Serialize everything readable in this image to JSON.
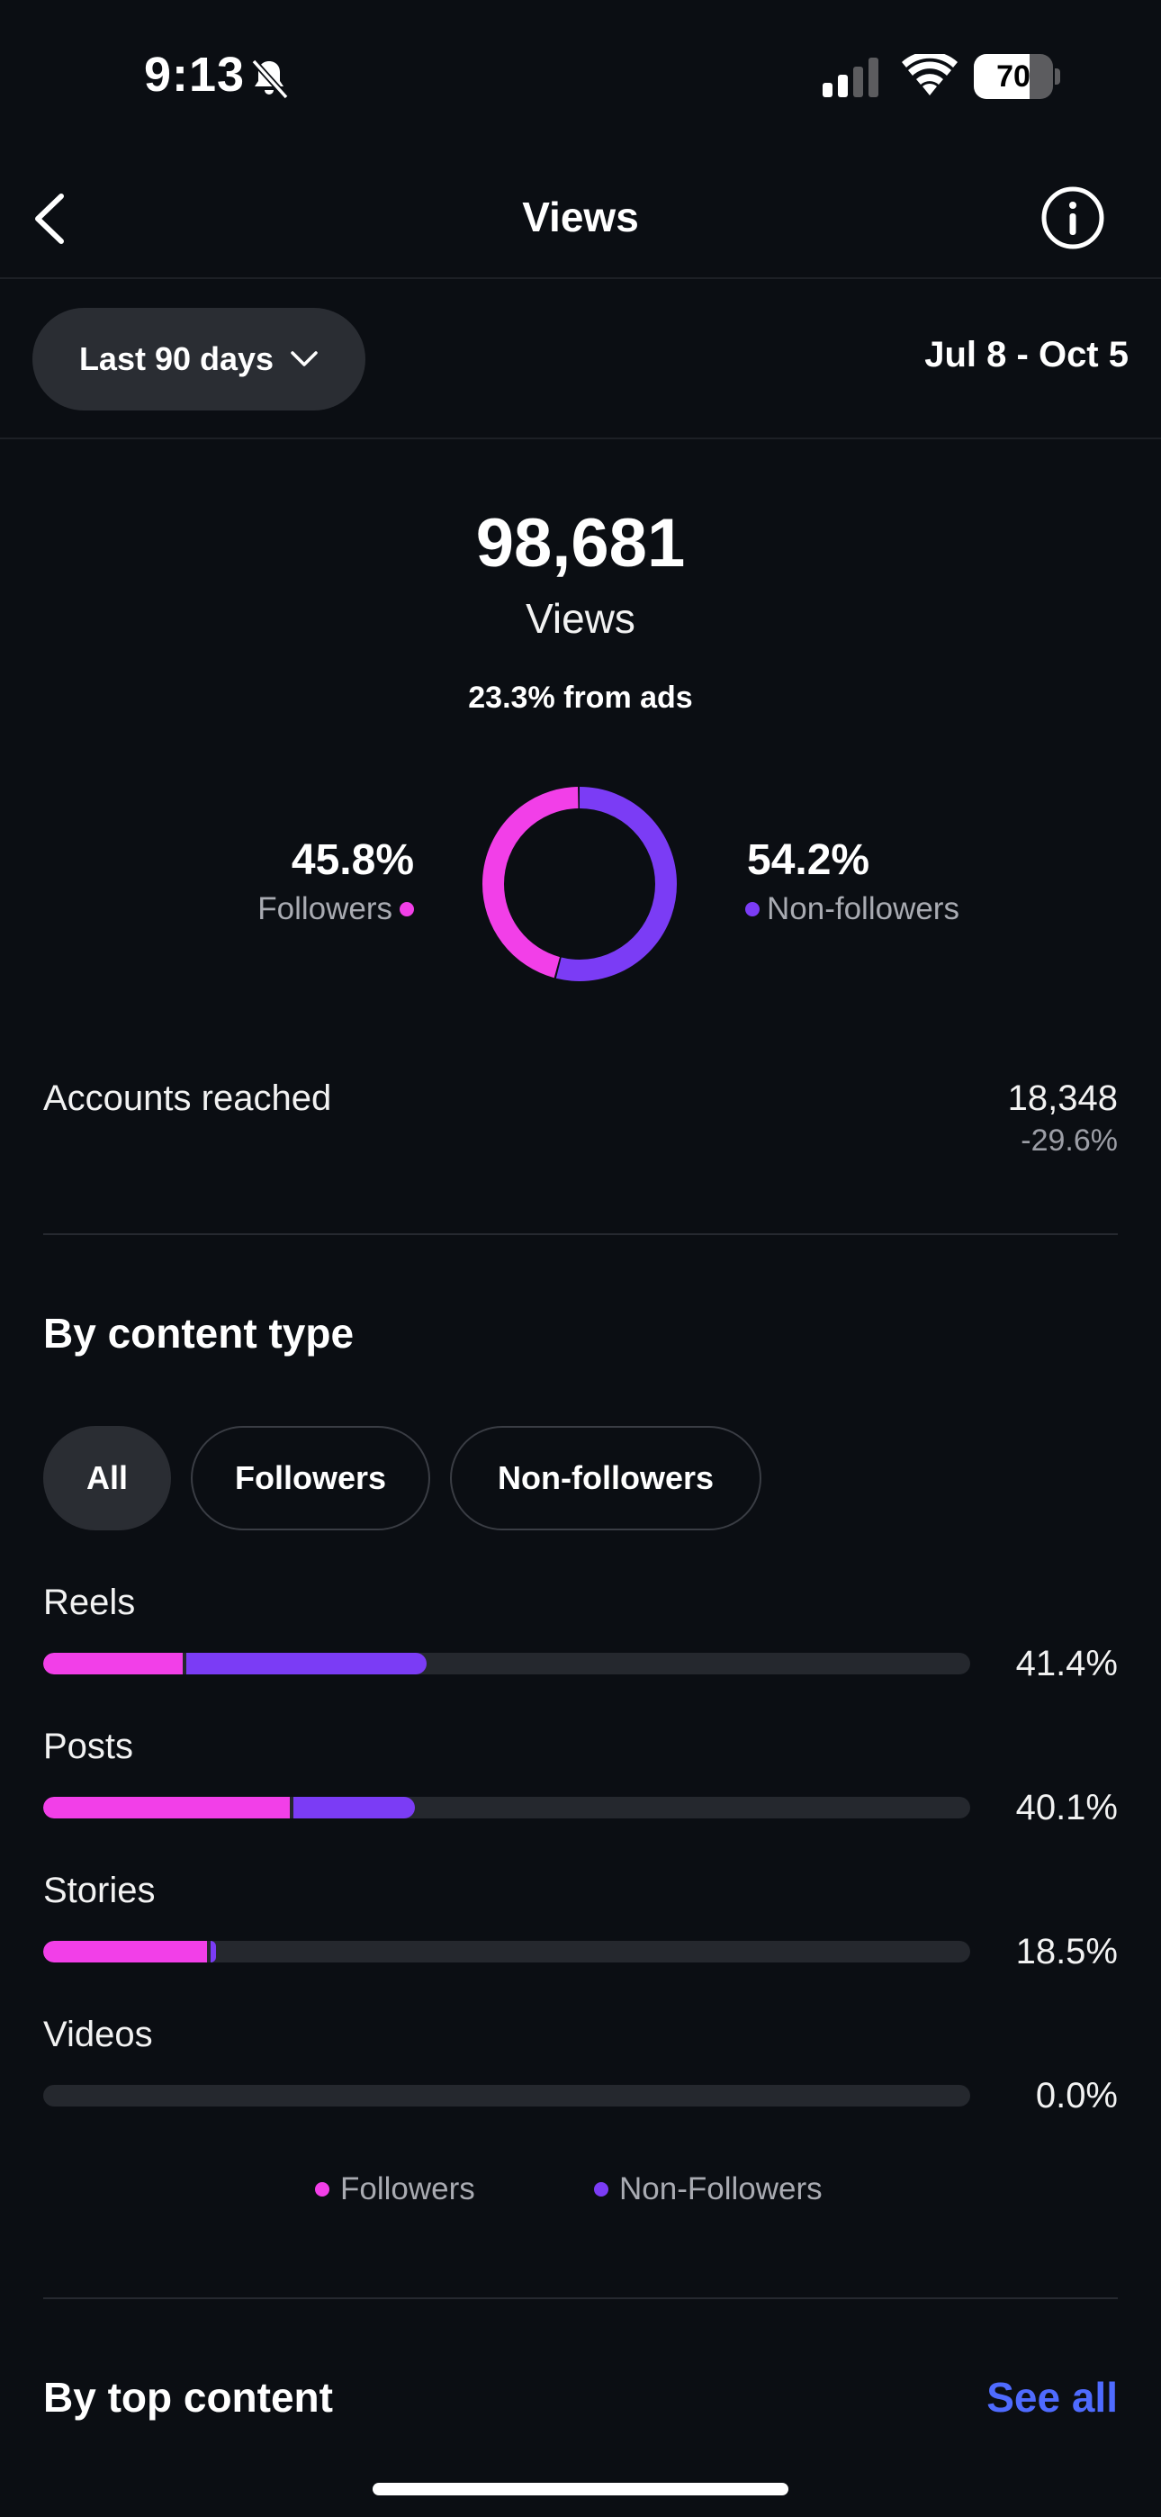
{
  "status_bar": {
    "time": "9:13",
    "battery": "70",
    "battery_level": 0.7,
    "icons": [
      "bell-slash-icon",
      "cellular-signal-icon",
      "wifi-icon",
      "battery-icon"
    ]
  },
  "header": {
    "title": "Views",
    "back_icon": "chevron-left-icon",
    "info_icon": "info-icon"
  },
  "range": {
    "label": "Last 90 days",
    "dates": "Jul 8 - Oct 5"
  },
  "summary": {
    "total": "98,681",
    "label": "Views",
    "ads_note": "23.3% from ads",
    "followers_pct": "45.8%",
    "followers_label": "Followers",
    "nonfollowers_pct": "54.2%",
    "nonfollowers_label": "Non-followers",
    "followers_share": 45.8,
    "nonfollowers_share": 54.2
  },
  "accounts": {
    "label": "Accounts reached",
    "value": "18,348",
    "change": "-29.6%"
  },
  "content_type": {
    "title": "By content type",
    "filters": [
      "All",
      "Followers",
      "Non-followers"
    ],
    "active_filter": "All",
    "rows": [
      {
        "label": "Reels",
        "pct": "41.4%",
        "followers_share": 15.0,
        "nonfollowers_share": 26.4
      },
      {
        "label": "Posts",
        "pct": "40.1%",
        "followers_share": 26.6,
        "nonfollowers_share": 13.5
      },
      {
        "label": "Stories",
        "pct": "18.5%",
        "followers_share": 17.7,
        "nonfollowers_share": 0.8
      },
      {
        "label": "Videos",
        "pct": "0.0%",
        "followers_share": 0.0,
        "nonfollowers_share": 0.0
      }
    ],
    "legend_followers": "Followers",
    "legend_nonfollowers": "Non-Followers"
  },
  "top_content": {
    "title": "By top content",
    "see_all": "See all"
  },
  "colors": {
    "followers": "#f23fe8",
    "nonfollowers": "#7b3cf5",
    "accent": "#4f6bff",
    "background": "#0b0e13"
  }
}
